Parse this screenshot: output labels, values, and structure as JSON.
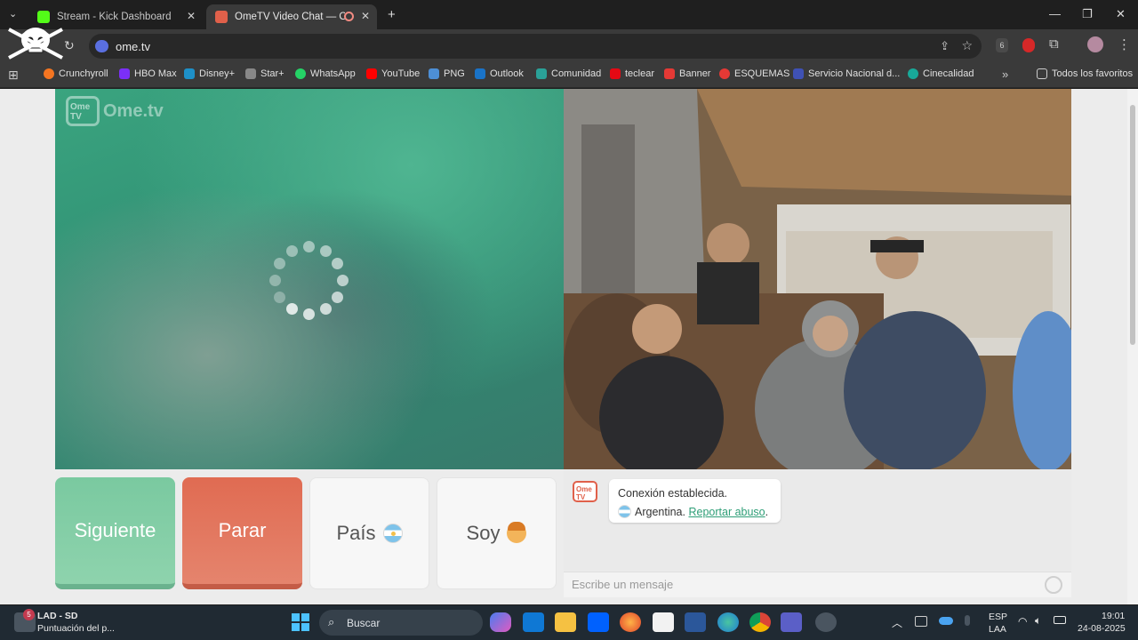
{
  "browser": {
    "tabs": [
      {
        "title": "Stream - Kick Dashboard",
        "active": false
      },
      {
        "title": "OmeTV Video Chat — Ome",
        "active": true
      }
    ],
    "url": "ome.tv",
    "profile_count": "6",
    "bookmarks": [
      {
        "label": "Crunchyroll",
        "icon": "crunchyroll-icon",
        "color": "#f47521"
      },
      {
        "label": "HBO Max",
        "icon": "hbomax-icon",
        "color": "#7b2ff7"
      },
      {
        "label": "Disney+",
        "icon": "disney-icon",
        "color": "#1e90c8"
      },
      {
        "label": "Star+",
        "icon": "star-plus-icon",
        "color": "#888888"
      },
      {
        "label": "WhatsApp",
        "icon": "whatsapp-icon",
        "color": "#25d366"
      },
      {
        "label": "YouTube",
        "icon": "youtube-icon",
        "color": "#ff0000"
      },
      {
        "label": "PNG",
        "icon": "png-icon",
        "color": "#4d8fd6"
      },
      {
        "label": "Outlook",
        "icon": "outlook-icon",
        "color": "#1a73c7"
      },
      {
        "label": "Comunidad",
        "icon": "comunidad-icon",
        "color": "#2aa198"
      },
      {
        "label": "teclear",
        "icon": "netflix-icon",
        "color": "#e50914"
      },
      {
        "label": "Banner",
        "icon": "banner-icon",
        "color": "#e53935"
      },
      {
        "label": "ESQUEMAS",
        "icon": "esquemas-icon",
        "color": "#e53935"
      },
      {
        "label": "Servicio Nacional d...",
        "icon": "servicio-icon",
        "color": "#3f51b5"
      },
      {
        "label": "Cinecalidad",
        "icon": "cinecalidad-icon",
        "color": "#18a999"
      }
    ],
    "favorites_label": "Todos los favoritos"
  },
  "page": {
    "logo_text": "Ome.tv",
    "logo_badge": "Ome TV",
    "buttons": {
      "next": "Siguiente",
      "stop": "Parar",
      "country": "País",
      "gender": "Soy"
    },
    "chat": {
      "status": "Conexión establecida.",
      "country": "Argentina.",
      "report_link": "Reportar abuso",
      "placeholder": "Escribe un mensaje"
    }
  },
  "taskbar": {
    "notification_count": "5",
    "widget_title": "LAD - SD",
    "widget_subtitle": "Puntuación del p...",
    "search_placeholder": "Buscar",
    "language": "ESP",
    "layout": "LAA",
    "time": "19:01",
    "date": "24-08-2025"
  },
  "colors": {
    "next_button": "#7ac9a0",
    "stop_button": "#e06b52",
    "link": "#2e9e77"
  }
}
